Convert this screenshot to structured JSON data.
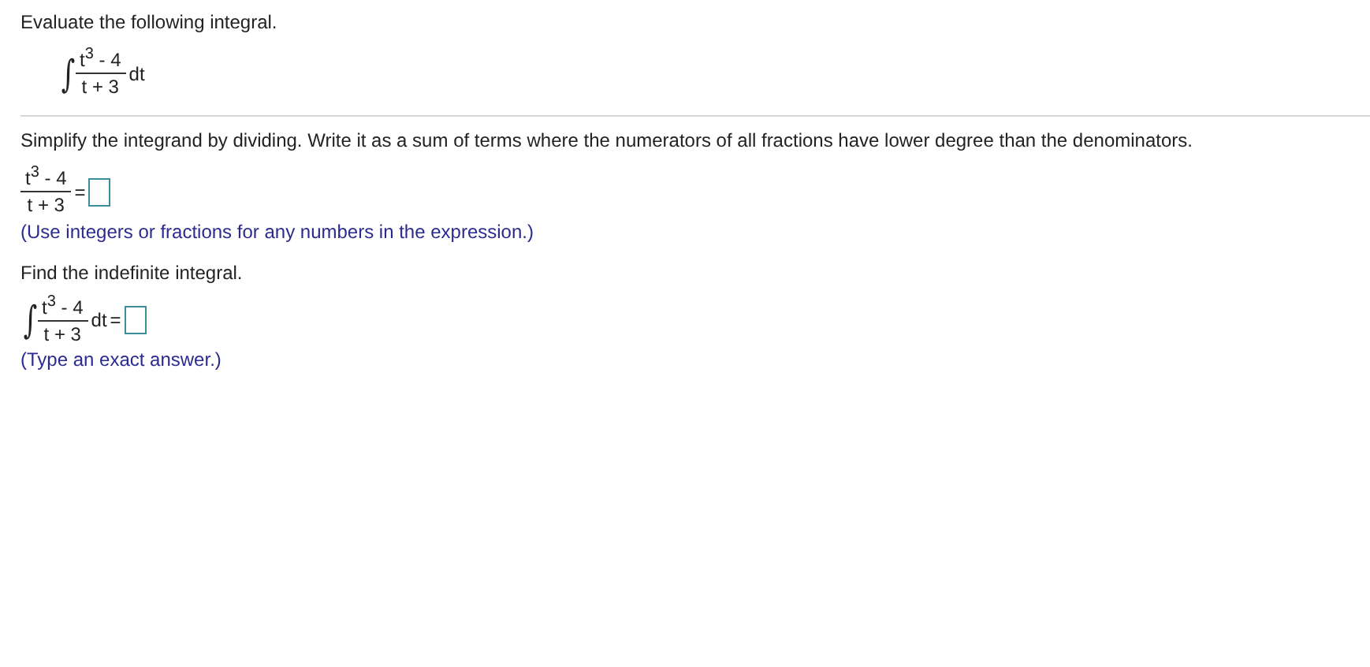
{
  "prompt": "Evaluate the following integral.",
  "integral": {
    "sign": "∫",
    "numerator": "t$^{3}$ - 4",
    "denominator": "t + 3",
    "differential": "dt"
  },
  "parts": [
    {
      "instruction": "Simplify the integrand by dividing. Write it as a sum of terms where the numerators of all fractions have lower degree than the denominators.",
      "kind": "fraction",
      "expression": {
        "numerator": "t$^{3}$ - 4",
        "denominator": "t + 3",
        "equals": "="
      },
      "hint": "(Use integers or fractions for any numbers in the expression.)"
    },
    {
      "instruction": "Find the indefinite integral.",
      "kind": "integral",
      "expression": {
        "sign": "∫",
        "numerator": "t$^{3}$ - 4",
        "denominator": "t + 3",
        "differential": "dt",
        "equals": "="
      },
      "hint": "(Type an exact answer.)"
    }
  ]
}
